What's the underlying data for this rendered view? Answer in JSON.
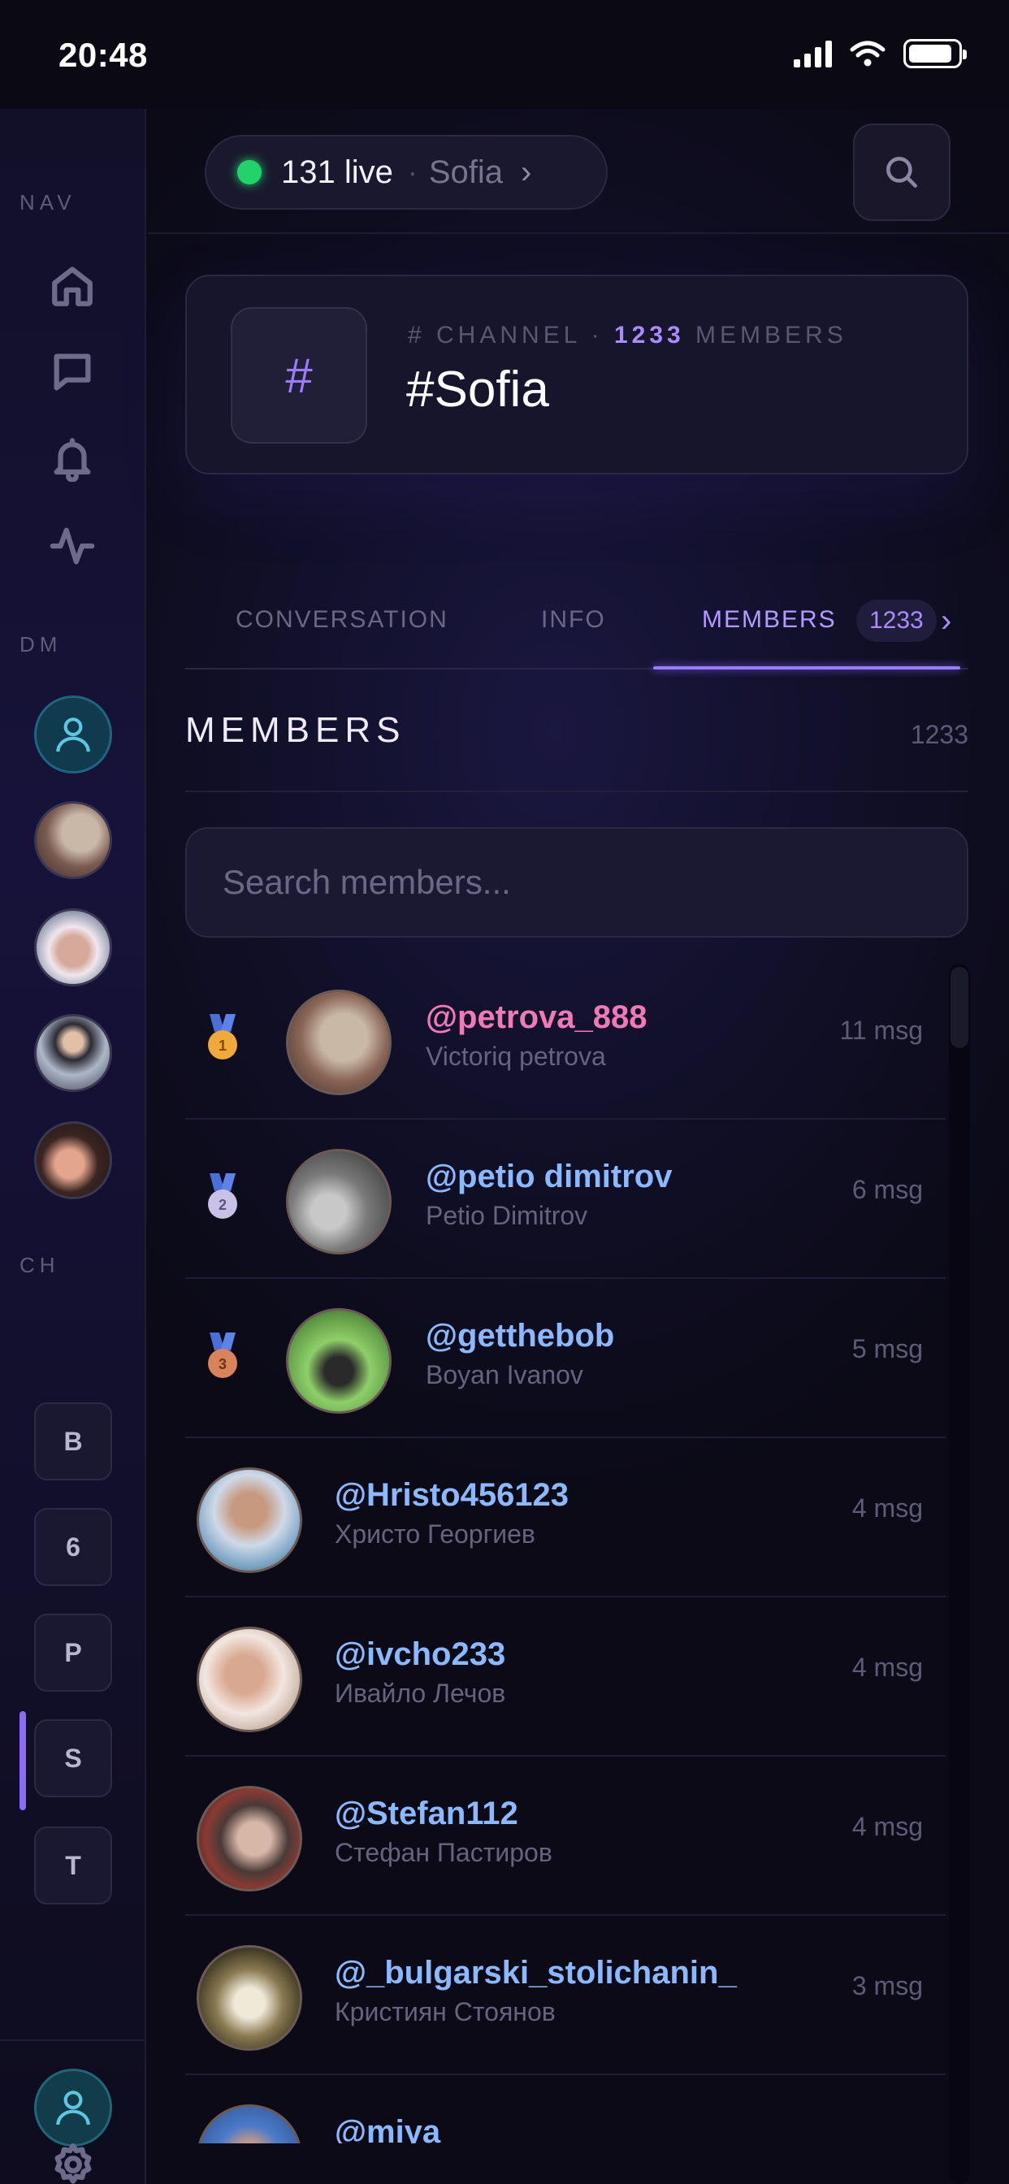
{
  "status_bar": {
    "time": "20:48",
    "battery_level": 0.9
  },
  "sidebar": {
    "sections": {
      "nav": "NAV",
      "dm": "DM",
      "ch": "CH"
    },
    "nav_icons": [
      "home-icon",
      "chat-icon",
      "bell-icon",
      "activity-icon"
    ],
    "channels": [
      "B",
      "6",
      "P",
      "S",
      "T"
    ],
    "active_channel": "S"
  },
  "topbar": {
    "live_count": "131 live",
    "separator": "·",
    "city": "Sofia",
    "chevron": "›"
  },
  "channel": {
    "icon": "#",
    "meta_prefix": "# CHANNEL ·",
    "members_count": "1233",
    "meta_suffix": "MEMBERS",
    "name": "#Sofia"
  },
  "tabs": {
    "conversation": "CONVERSATION",
    "info": "INFO",
    "members": "MEMBERS",
    "members_count": "1233",
    "chevron": "›"
  },
  "members_section": {
    "title": "MEMBERS",
    "count": "1233",
    "search_placeholder": "Search members..."
  },
  "members": [
    {
      "rank": "1",
      "handle": "@petrova_888",
      "name": "Victoriq petrova",
      "messages": "11 msg"
    },
    {
      "rank": "2",
      "handle": "@petio dimitrov",
      "name": "Petio Dimitrov",
      "messages": "6 msg"
    },
    {
      "rank": "3",
      "handle": "@getthebob",
      "name": "Boyan Ivanov",
      "messages": "5 msg"
    },
    {
      "rank": "",
      "handle": "@Hristo456123",
      "name": "Христо Георгиев",
      "messages": "4 msg"
    },
    {
      "rank": "",
      "handle": "@ivcho233",
      "name": "Ивайло Лечов",
      "messages": "4 msg"
    },
    {
      "rank": "",
      "handle": "@Stefan112",
      "name": "Стефан Пастиров",
      "messages": "4 msg"
    },
    {
      "rank": "",
      "handle": "@_bulgarski_stolichanin_",
      "name": "Кристиян Стоянов",
      "messages": "3 msg"
    },
    {
      "rank": "",
      "handle": "@miya",
      "name": "",
      "messages": ""
    }
  ],
  "colors": {
    "accent": "#9b7bff",
    "live": "#22d36a",
    "handle_top": "#f07ab8",
    "handle": "#8cb8ff",
    "medal_gold": "#f2a93b",
    "medal_silver": "#c9c2e6",
    "medal_bronze": "#d9835a"
  }
}
